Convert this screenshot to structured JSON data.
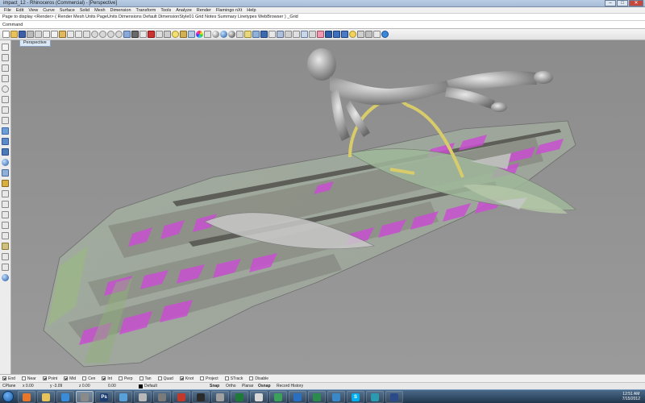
{
  "window": {
    "title": "impact_12 - Rhinoceros (Commercial) - [Perspective]",
    "min": "–",
    "max": "□",
    "close": "✕"
  },
  "menu": [
    "File",
    "Edit",
    "View",
    "Curve",
    "Surface",
    "Solid",
    "Mesh",
    "Dimension",
    "Transform",
    "Tools",
    "Analyze",
    "Render",
    "Flamingo nXt",
    "Help"
  ],
  "command_history": "Page to display <Render> ( Render Mesh Units PageUnits Dimensions Default DimensionStyle01 Grid Notes Summary Linetypes WebBrowser ) _Grid",
  "command_prompt": "Command",
  "viewport": {
    "tab": "Perspective"
  },
  "osnaps": [
    {
      "label": "End",
      "on": true
    },
    {
      "label": "Near",
      "on": false
    },
    {
      "label": "Point",
      "on": true
    },
    {
      "label": "Mid",
      "on": true
    },
    {
      "label": "Cen",
      "on": false
    },
    {
      "label": "Int",
      "on": true
    },
    {
      "label": "Perp",
      "on": false
    },
    {
      "label": "Tan",
      "on": false
    },
    {
      "label": "Quad",
      "on": false
    },
    {
      "label": "Knot",
      "on": true
    },
    {
      "label": "Project",
      "on": false
    },
    {
      "label": "STrack",
      "on": false
    },
    {
      "label": "Disable",
      "on": false
    }
  ],
  "status": {
    "cplane": "CPlane",
    "x": "x 0.00",
    "y": "y -3.09",
    "z": "z 0.00",
    "dist": "0.00",
    "layer": "Default",
    "panes": [
      {
        "label": "Snap",
        "bold": true
      },
      {
        "label": "Ortho",
        "bold": false
      },
      {
        "label": "Planar",
        "bold": false
      },
      {
        "label": "Osnap",
        "bold": true
      },
      {
        "label": "Record History",
        "bold": false
      }
    ]
  },
  "taskbar": {
    "apps": [
      {
        "icon": "firefox-icon",
        "label": "",
        "color": "#e8762b",
        "active": false
      },
      {
        "icon": "explorer-icon",
        "label": "",
        "color": "#e6c25a",
        "active": false
      },
      {
        "icon": "media-player-icon",
        "label": "",
        "color": "#3a8bd8",
        "active": false
      },
      {
        "icon": "rhino-icon",
        "label": "",
        "color": "#8a8a8a",
        "active": true
      },
      {
        "icon": "photoshop-icon",
        "label": "Ps",
        "color": "#1d3e72",
        "active": false
      },
      {
        "icon": "app-icon",
        "label": "",
        "color": "#5aa0d8",
        "active": false
      },
      {
        "icon": "autodesk-icon",
        "label": "",
        "color": "#b8b8b8",
        "active": false
      },
      {
        "icon": "sketch-icon",
        "label": "",
        "color": "#7a7a7a",
        "active": false
      },
      {
        "icon": "app-red-icon",
        "label": "",
        "color": "#c0392b",
        "active": false
      },
      {
        "icon": "app-dark-icon",
        "label": "",
        "color": "#2b2b2b",
        "active": false
      },
      {
        "icon": "app-gray-icon",
        "label": "",
        "color": "#a0a0a0",
        "active": false
      },
      {
        "icon": "excel-icon",
        "label": "",
        "color": "#1f7a3a",
        "active": false
      },
      {
        "icon": "app-light-icon",
        "label": "",
        "color": "#d8d8d8",
        "active": false
      },
      {
        "icon": "chrome-icon",
        "label": "",
        "color": "#3aa05a",
        "active": false
      },
      {
        "icon": "app-blue-icon",
        "label": "",
        "color": "#2b6fc0",
        "active": false
      },
      {
        "icon": "app-green-icon",
        "label": "",
        "color": "#2d8a4f",
        "active": false
      },
      {
        "icon": "app-globe-icon",
        "label": "",
        "color": "#3a88c8",
        "active": false
      },
      {
        "icon": "skype-icon",
        "label": "S",
        "color": "#00aff0",
        "active": false
      },
      {
        "icon": "app-teal-icon",
        "label": "",
        "color": "#2a9ab0",
        "active": false
      },
      {
        "icon": "app-navy-icon",
        "label": "",
        "color": "#2b4a8a",
        "active": false
      }
    ],
    "clock_time": "12:51 AM",
    "clock_date": "7/15/2012"
  }
}
